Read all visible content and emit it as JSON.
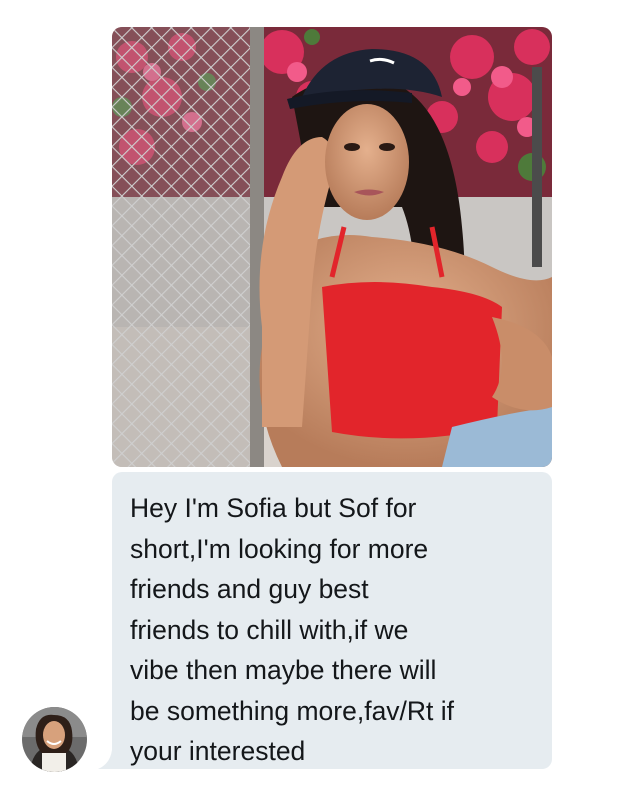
{
  "conversation": {
    "message": {
      "text": "Hey I'm Sofia but Sof for\nshort,I'm looking for more\nfriends and guy best\nfriends to chill with,if we\nvibe then maybe there will\nbe something more,fav/Rt if\nyour interested"
    },
    "attachment": {
      "type": "photo"
    },
    "sender": {
      "avatar_icon": "user-avatar-icon"
    }
  },
  "colors": {
    "bubble_background": "#e6ecf0",
    "bubble_text": "#14171a",
    "page_background": "#ffffff"
  }
}
